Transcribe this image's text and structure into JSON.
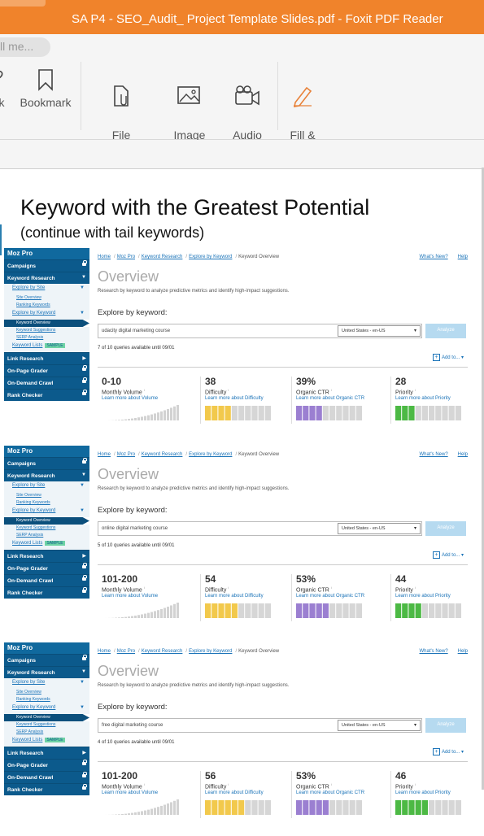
{
  "window": {
    "title": "SA P4 - SEO_Audit_ Project Template Slides.pdf - Foxit PDF Reader"
  },
  "ribbon": {
    "tell_me": "ll me...",
    "buttons": [
      {
        "label": "k",
        "icon": "link-icon"
      },
      {
        "label": "Bookmark",
        "icon": "bookmark-icon"
      },
      {
        "label": "File\nAttachment",
        "icon": "file-attachment-icon"
      },
      {
        "label": "Image\nAnnotation",
        "icon": "image-annotation-icon"
      },
      {
        "label": "Audio\n& Video",
        "icon": "audio-video-icon"
      },
      {
        "label": "Fill &\nSign",
        "icon": "pen-icon"
      }
    ]
  },
  "slide": {
    "title": "Keyword with the Greatest Potential",
    "subtitle": "(continue with tail keywords)"
  },
  "moz": {
    "brand": "Moz Pro",
    "nav": {
      "campaigns": "Campaigns",
      "keyword_research": "Keyword Research",
      "explore_by_site": "Explore by Site",
      "site_overview": "Site Overview",
      "ranking_keywords": "Ranking Keywords",
      "explore_by_keyword": "Explore by Keyword",
      "keyword_overview": "Keyword Overview",
      "keyword_suggestions": "Keyword Suggestions",
      "serp_analysis": "SERP Analysis",
      "keyword_lists": "Keyword Lists",
      "sample": "SAMPLE",
      "link_research": "Link Research",
      "on_page_grader": "On-Page Grader",
      "on_demand_crawl": "On-Demand Crawl",
      "rank_checker": "Rank Checker"
    },
    "crumbs": [
      "Home",
      "Moz Pro",
      "Keyword Research",
      "Explore by Keyword",
      "Keyword Overview"
    ],
    "whats_new": "What's New?",
    "help": "Help",
    "overview_title": "Overview",
    "overview_desc": "Research by keyword to analyze predictive metrics and identify high-impact suggestions.",
    "explore_label": "Explore by keyword:",
    "locale": "United States - en-US",
    "analyze": "Analyze",
    "add_to": "Add to...",
    "metric_labels": {
      "volume": "Monthly Volume",
      "difficulty": "Difficulty",
      "ctr": "Organic CTR",
      "priority": "Priority"
    },
    "learn_links": {
      "volume": "Learn more about Volume",
      "difficulty": "Learn more about Difficulty",
      "ctr": "Learn more about Organic CTR",
      "priority": "Learn more about Priority"
    },
    "panels": [
      {
        "keyword": "udacity digital marketing course",
        "queries": "7 of 10 queries available until 09/01",
        "volume": "0-10",
        "difficulty": "38",
        "ctr": "39%",
        "priority": "28"
      },
      {
        "keyword": "online digital marketing course",
        "queries": "5 of 10 queries available until 09/01",
        "volume": "101-200",
        "difficulty": "54",
        "ctr": "53%",
        "priority": "44"
      },
      {
        "keyword": "free digital marketing course",
        "queries": "4 of 10 queries available until 09/01",
        "volume": "101-200",
        "difficulty": "56",
        "ctr": "53%",
        "priority": "46"
      }
    ],
    "colors": {
      "navy": "#0c5a8c",
      "difficulty": "#f2c94c",
      "ctr": "#9b7fd1",
      "priority": "#4cb944",
      "empty": "#d6d6d6"
    }
  }
}
